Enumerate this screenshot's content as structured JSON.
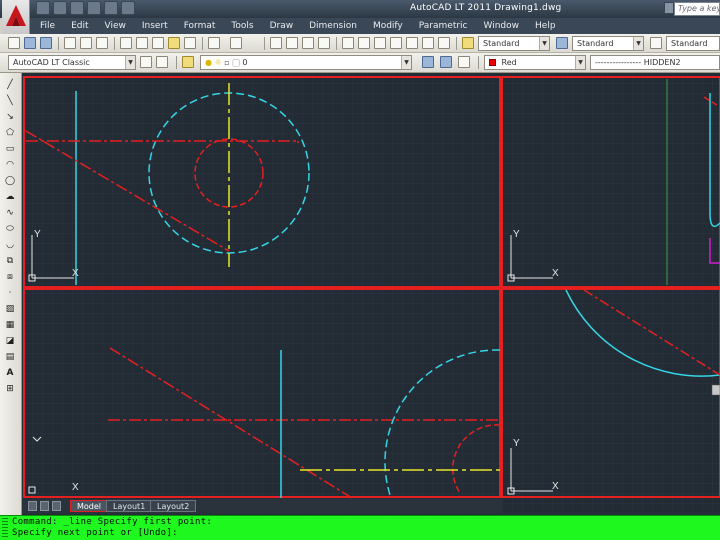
{
  "title_bar": {
    "title": "AutoCAD LT 2011    Drawing1.dwg",
    "search_placeholder": "Type a keyword"
  },
  "menu": {
    "items": [
      "File",
      "Edit",
      "View",
      "Insert",
      "Format",
      "Tools",
      "Draw",
      "Dimension",
      "Modify",
      "Parametric",
      "Window",
      "Help"
    ]
  },
  "toolbar": {
    "text_style": "Standard",
    "dim_style": "Standard",
    "table_style": "Standard",
    "workspace": "AutoCAD LT Classic",
    "layer": "0",
    "color": "Red",
    "linetype": "---------------- HIDDEN2"
  },
  "colors": {
    "background": "#232b35",
    "cyan_lines": "#35d6e6",
    "red_lines": "#e62020",
    "yellow_lines": "#e6e62a",
    "command_line": "#1ef81e"
  },
  "viewports": {
    "ucs_y": "Y",
    "ucs_x": "X"
  },
  "tabs": {
    "items": [
      "Model",
      "Layout1",
      "Layout2"
    ],
    "active": "Model"
  },
  "command_line": {
    "line1": "Command: _line Specify first point:",
    "line2": "Specify next point or [Undo]:"
  }
}
